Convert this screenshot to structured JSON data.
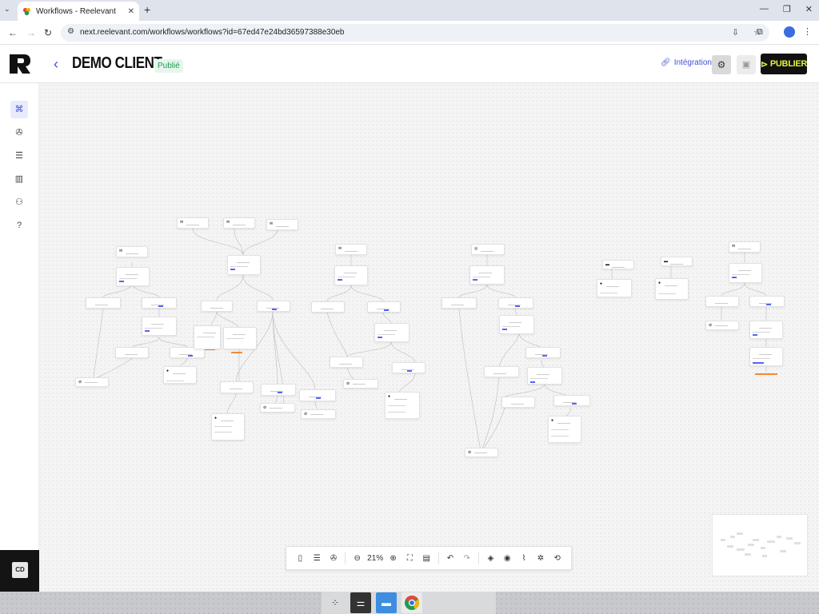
{
  "browser": {
    "tab_title": "Workflows - Reelevant",
    "url": "next.reelevant.com/workflows/workflows?id=67ed47e24bd36597388e30eb"
  },
  "header": {
    "title": "DEMO CLIENT",
    "status": "Publié",
    "integration_label": "Intégration",
    "publish_label": "PUBLIER"
  },
  "sidebar": {
    "avatar_initials": "CD",
    "items": [
      "workflow-icon",
      "widget-icon",
      "database-icon",
      "analytics-icon",
      "users-icon",
      "help-icon"
    ]
  },
  "toolbar": {
    "zoom": "21%"
  },
  "colors": {
    "accent": "#3f51d6",
    "publish_bg": "#111111",
    "publish_text": "#e2f23c",
    "status_bg": "#e6f6ec",
    "status_text": "#1e9b52"
  }
}
